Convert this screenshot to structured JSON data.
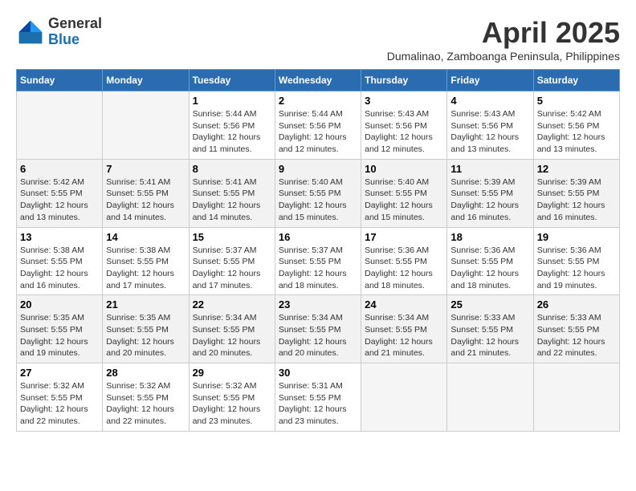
{
  "header": {
    "logo_general": "General",
    "logo_blue": "Blue",
    "month_title": "April 2025",
    "subtitle": "Dumalinao, Zamboanga Peninsula, Philippines"
  },
  "days_of_week": [
    "Sunday",
    "Monday",
    "Tuesday",
    "Wednesday",
    "Thursday",
    "Friday",
    "Saturday"
  ],
  "weeks": [
    [
      {
        "day": "",
        "sunrise": "",
        "sunset": "",
        "daylight": ""
      },
      {
        "day": "",
        "sunrise": "",
        "sunset": "",
        "daylight": ""
      },
      {
        "day": "1",
        "sunrise": "Sunrise: 5:44 AM",
        "sunset": "Sunset: 5:56 PM",
        "daylight": "Daylight: 12 hours and 11 minutes."
      },
      {
        "day": "2",
        "sunrise": "Sunrise: 5:44 AM",
        "sunset": "Sunset: 5:56 PM",
        "daylight": "Daylight: 12 hours and 12 minutes."
      },
      {
        "day": "3",
        "sunrise": "Sunrise: 5:43 AM",
        "sunset": "Sunset: 5:56 PM",
        "daylight": "Daylight: 12 hours and 12 minutes."
      },
      {
        "day": "4",
        "sunrise": "Sunrise: 5:43 AM",
        "sunset": "Sunset: 5:56 PM",
        "daylight": "Daylight: 12 hours and 13 minutes."
      },
      {
        "day": "5",
        "sunrise": "Sunrise: 5:42 AM",
        "sunset": "Sunset: 5:56 PM",
        "daylight": "Daylight: 12 hours and 13 minutes."
      }
    ],
    [
      {
        "day": "6",
        "sunrise": "Sunrise: 5:42 AM",
        "sunset": "Sunset: 5:55 PM",
        "daylight": "Daylight: 12 hours and 13 minutes."
      },
      {
        "day": "7",
        "sunrise": "Sunrise: 5:41 AM",
        "sunset": "Sunset: 5:55 PM",
        "daylight": "Daylight: 12 hours and 14 minutes."
      },
      {
        "day": "8",
        "sunrise": "Sunrise: 5:41 AM",
        "sunset": "Sunset: 5:55 PM",
        "daylight": "Daylight: 12 hours and 14 minutes."
      },
      {
        "day": "9",
        "sunrise": "Sunrise: 5:40 AM",
        "sunset": "Sunset: 5:55 PM",
        "daylight": "Daylight: 12 hours and 15 minutes."
      },
      {
        "day": "10",
        "sunrise": "Sunrise: 5:40 AM",
        "sunset": "Sunset: 5:55 PM",
        "daylight": "Daylight: 12 hours and 15 minutes."
      },
      {
        "day": "11",
        "sunrise": "Sunrise: 5:39 AM",
        "sunset": "Sunset: 5:55 PM",
        "daylight": "Daylight: 12 hours and 16 minutes."
      },
      {
        "day": "12",
        "sunrise": "Sunrise: 5:39 AM",
        "sunset": "Sunset: 5:55 PM",
        "daylight": "Daylight: 12 hours and 16 minutes."
      }
    ],
    [
      {
        "day": "13",
        "sunrise": "Sunrise: 5:38 AM",
        "sunset": "Sunset: 5:55 PM",
        "daylight": "Daylight: 12 hours and 16 minutes."
      },
      {
        "day": "14",
        "sunrise": "Sunrise: 5:38 AM",
        "sunset": "Sunset: 5:55 PM",
        "daylight": "Daylight: 12 hours and 17 minutes."
      },
      {
        "day": "15",
        "sunrise": "Sunrise: 5:37 AM",
        "sunset": "Sunset: 5:55 PM",
        "daylight": "Daylight: 12 hours and 17 minutes."
      },
      {
        "day": "16",
        "sunrise": "Sunrise: 5:37 AM",
        "sunset": "Sunset: 5:55 PM",
        "daylight": "Daylight: 12 hours and 18 minutes."
      },
      {
        "day": "17",
        "sunrise": "Sunrise: 5:36 AM",
        "sunset": "Sunset: 5:55 PM",
        "daylight": "Daylight: 12 hours and 18 minutes."
      },
      {
        "day": "18",
        "sunrise": "Sunrise: 5:36 AM",
        "sunset": "Sunset: 5:55 PM",
        "daylight": "Daylight: 12 hours and 18 minutes."
      },
      {
        "day": "19",
        "sunrise": "Sunrise: 5:36 AM",
        "sunset": "Sunset: 5:55 PM",
        "daylight": "Daylight: 12 hours and 19 minutes."
      }
    ],
    [
      {
        "day": "20",
        "sunrise": "Sunrise: 5:35 AM",
        "sunset": "Sunset: 5:55 PM",
        "daylight": "Daylight: 12 hours and 19 minutes."
      },
      {
        "day": "21",
        "sunrise": "Sunrise: 5:35 AM",
        "sunset": "Sunset: 5:55 PM",
        "daylight": "Daylight: 12 hours and 20 minutes."
      },
      {
        "day": "22",
        "sunrise": "Sunrise: 5:34 AM",
        "sunset": "Sunset: 5:55 PM",
        "daylight": "Daylight: 12 hours and 20 minutes."
      },
      {
        "day": "23",
        "sunrise": "Sunrise: 5:34 AM",
        "sunset": "Sunset: 5:55 PM",
        "daylight": "Daylight: 12 hours and 20 minutes."
      },
      {
        "day": "24",
        "sunrise": "Sunrise: 5:34 AM",
        "sunset": "Sunset: 5:55 PM",
        "daylight": "Daylight: 12 hours and 21 minutes."
      },
      {
        "day": "25",
        "sunrise": "Sunrise: 5:33 AM",
        "sunset": "Sunset: 5:55 PM",
        "daylight": "Daylight: 12 hours and 21 minutes."
      },
      {
        "day": "26",
        "sunrise": "Sunrise: 5:33 AM",
        "sunset": "Sunset: 5:55 PM",
        "daylight": "Daylight: 12 hours and 22 minutes."
      }
    ],
    [
      {
        "day": "27",
        "sunrise": "Sunrise: 5:32 AM",
        "sunset": "Sunset: 5:55 PM",
        "daylight": "Daylight: 12 hours and 22 minutes."
      },
      {
        "day": "28",
        "sunrise": "Sunrise: 5:32 AM",
        "sunset": "Sunset: 5:55 PM",
        "daylight": "Daylight: 12 hours and 22 minutes."
      },
      {
        "day": "29",
        "sunrise": "Sunrise: 5:32 AM",
        "sunset": "Sunset: 5:55 PM",
        "daylight": "Daylight: 12 hours and 23 minutes."
      },
      {
        "day": "30",
        "sunrise": "Sunrise: 5:31 AM",
        "sunset": "Sunset: 5:55 PM",
        "daylight": "Daylight: 12 hours and 23 minutes."
      },
      {
        "day": "",
        "sunrise": "",
        "sunset": "",
        "daylight": ""
      },
      {
        "day": "",
        "sunrise": "",
        "sunset": "",
        "daylight": ""
      },
      {
        "day": "",
        "sunrise": "",
        "sunset": "",
        "daylight": ""
      }
    ]
  ]
}
